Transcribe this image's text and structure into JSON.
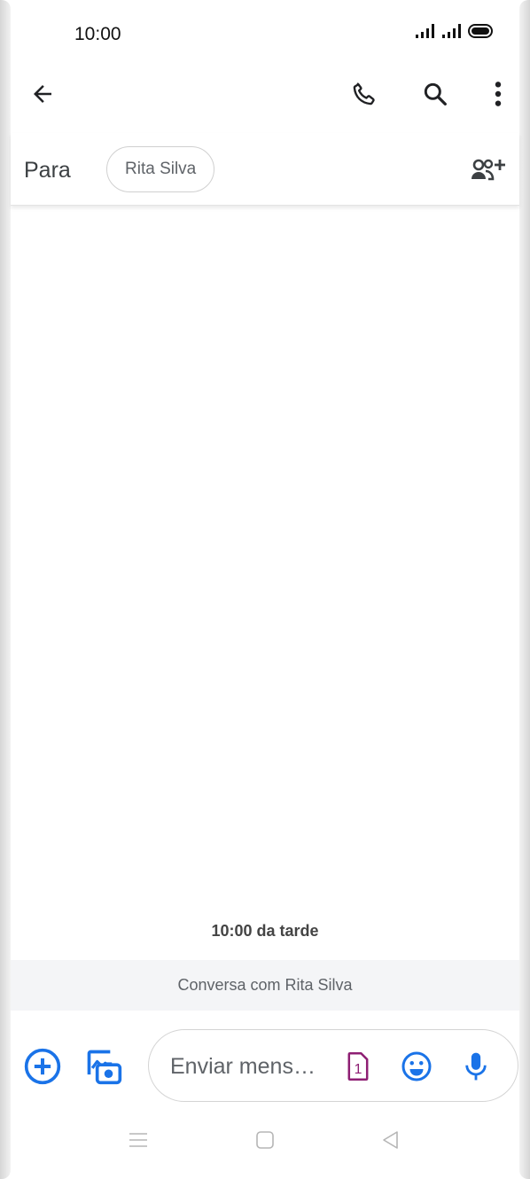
{
  "status_bar": {
    "time": "10:00",
    "icons": [
      "signal-icon",
      "signal-icon",
      "battery-icon"
    ]
  },
  "app_bar": {
    "icons": [
      "back-arrow-icon",
      "phone-icon",
      "search-icon",
      "more-vert-icon"
    ]
  },
  "recipients": {
    "to_label": "Para",
    "chips": [
      "Rita Silva"
    ],
    "add_icon": "add-people-icon"
  },
  "conversation": {
    "timestamp": "10:00 da tarde",
    "banner": "Conversa com Rita Silva"
  },
  "compose": {
    "placeholder": "Enviar mens…",
    "sim_number": "1",
    "icons": [
      "add-circle-icon",
      "gallery-camera-icon",
      "sim-card-icon",
      "emoji-icon",
      "mic-icon"
    ]
  },
  "colors": {
    "accent": "#1a73e8",
    "sim": "#8e1f73",
    "icon_dark": "#3c4043",
    "banner_bg": "#f4f5f7"
  },
  "nav_bar": {
    "icons": [
      "menu-icon",
      "home-icon",
      "back-triangle-icon"
    ]
  }
}
